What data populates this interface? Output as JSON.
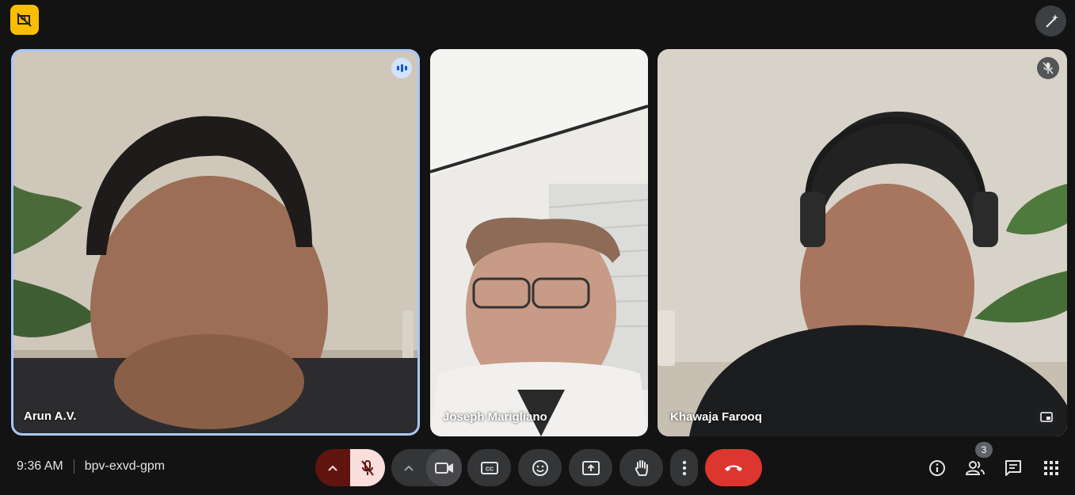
{
  "meeting": {
    "time": "9:36 AM",
    "code": "bpv-exvd-gpm"
  },
  "participants": [
    {
      "name": "Arun A.V.",
      "state": "speaking"
    },
    {
      "name": "Joseph Marigliano",
      "state": "normal"
    },
    {
      "name": "Khawaja Farooq",
      "state": "muted"
    }
  ],
  "people_count": "3",
  "icons": {
    "top_left": "recording-off-icon",
    "top_right": "visual-effects-icon",
    "controls": [
      "chevron-up-icon",
      "mic-off-icon",
      "chevron-up-icon",
      "camera-icon",
      "captions-icon",
      "emoji-icon",
      "present-screen-icon",
      "raise-hand-icon",
      "more-vert-icon",
      "call-end-icon"
    ],
    "right": [
      "info-icon",
      "people-icon",
      "chat-icon",
      "activities-icon"
    ]
  },
  "colors": {
    "background": "#131314",
    "accent_yellow": "#fbbc04",
    "leave_red": "#dc362e",
    "active_border": "#a8c7fa",
    "mic_off_bg": "#f9dedc"
  }
}
